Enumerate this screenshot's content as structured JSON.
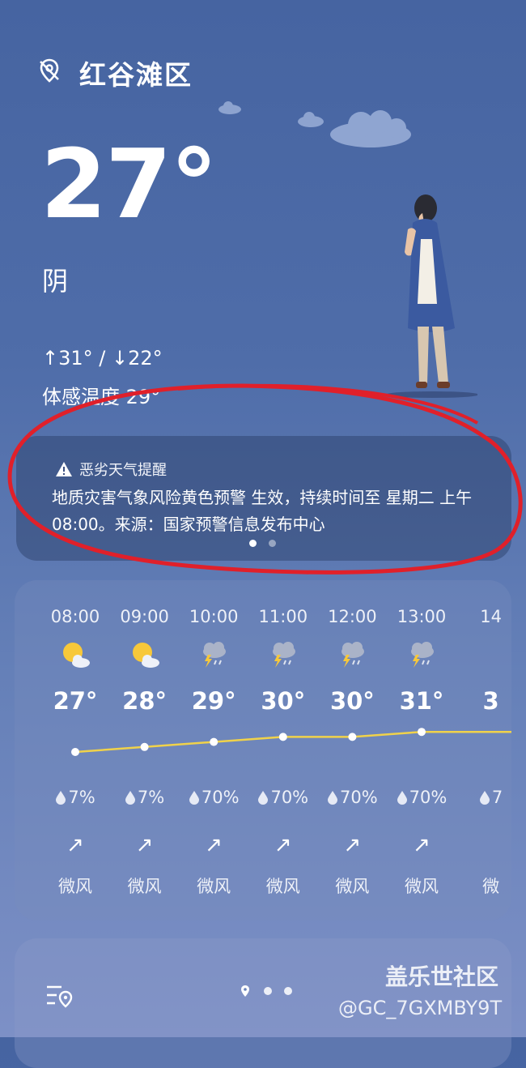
{
  "header": {
    "city": "红谷滩区"
  },
  "current": {
    "temperature": "27°",
    "condition": "阴",
    "high_low": "↑31° / ↓22°",
    "feels_like": "体感温度 29°"
  },
  "alert": {
    "title": "恶劣天气提醒",
    "body": "地质灾害气象风险黄色预警 生效，持续时间至 星期二 上午08:00。来源：国家预警信息发布中心",
    "pages": 2,
    "active_page": 1
  },
  "hourly": {
    "items": [
      {
        "time": "08:00",
        "icon": "partly-sunny-icon",
        "temp": "27°",
        "temp_value": 27,
        "precip": "7%",
        "wind": "微风"
      },
      {
        "time": "09:00",
        "icon": "partly-sunny-icon",
        "temp": "28°",
        "temp_value": 28,
        "precip": "7%",
        "wind": "微风"
      },
      {
        "time": "10:00",
        "icon": "thunderstorm-icon",
        "temp": "29°",
        "temp_value": 29,
        "precip": "70%",
        "wind": "微风"
      },
      {
        "time": "11:00",
        "icon": "thunderstorm-icon",
        "temp": "30°",
        "temp_value": 30,
        "precip": "70%",
        "wind": "微风"
      },
      {
        "time": "12:00",
        "icon": "thunderstorm-icon",
        "temp": "30°",
        "temp_value": 30,
        "precip": "70%",
        "wind": "微风"
      },
      {
        "time": "13:00",
        "icon": "thunderstorm-icon",
        "temp": "31°",
        "temp_value": 31,
        "precip": "70%",
        "wind": "微风"
      }
    ],
    "partial_next": {
      "time": "14",
      "temp": "3",
      "precip": "7",
      "wind": "微"
    }
  },
  "bottom_nav": {
    "pages": 3,
    "active_page": 1
  },
  "watermark": {
    "line1": "盖乐世社区",
    "line2": "@GC_7GXMBY9T"
  },
  "colors": {
    "temp_line": "#f0d24a",
    "alert_ring": "#e0202a",
    "sun": "#f7c83a"
  }
}
